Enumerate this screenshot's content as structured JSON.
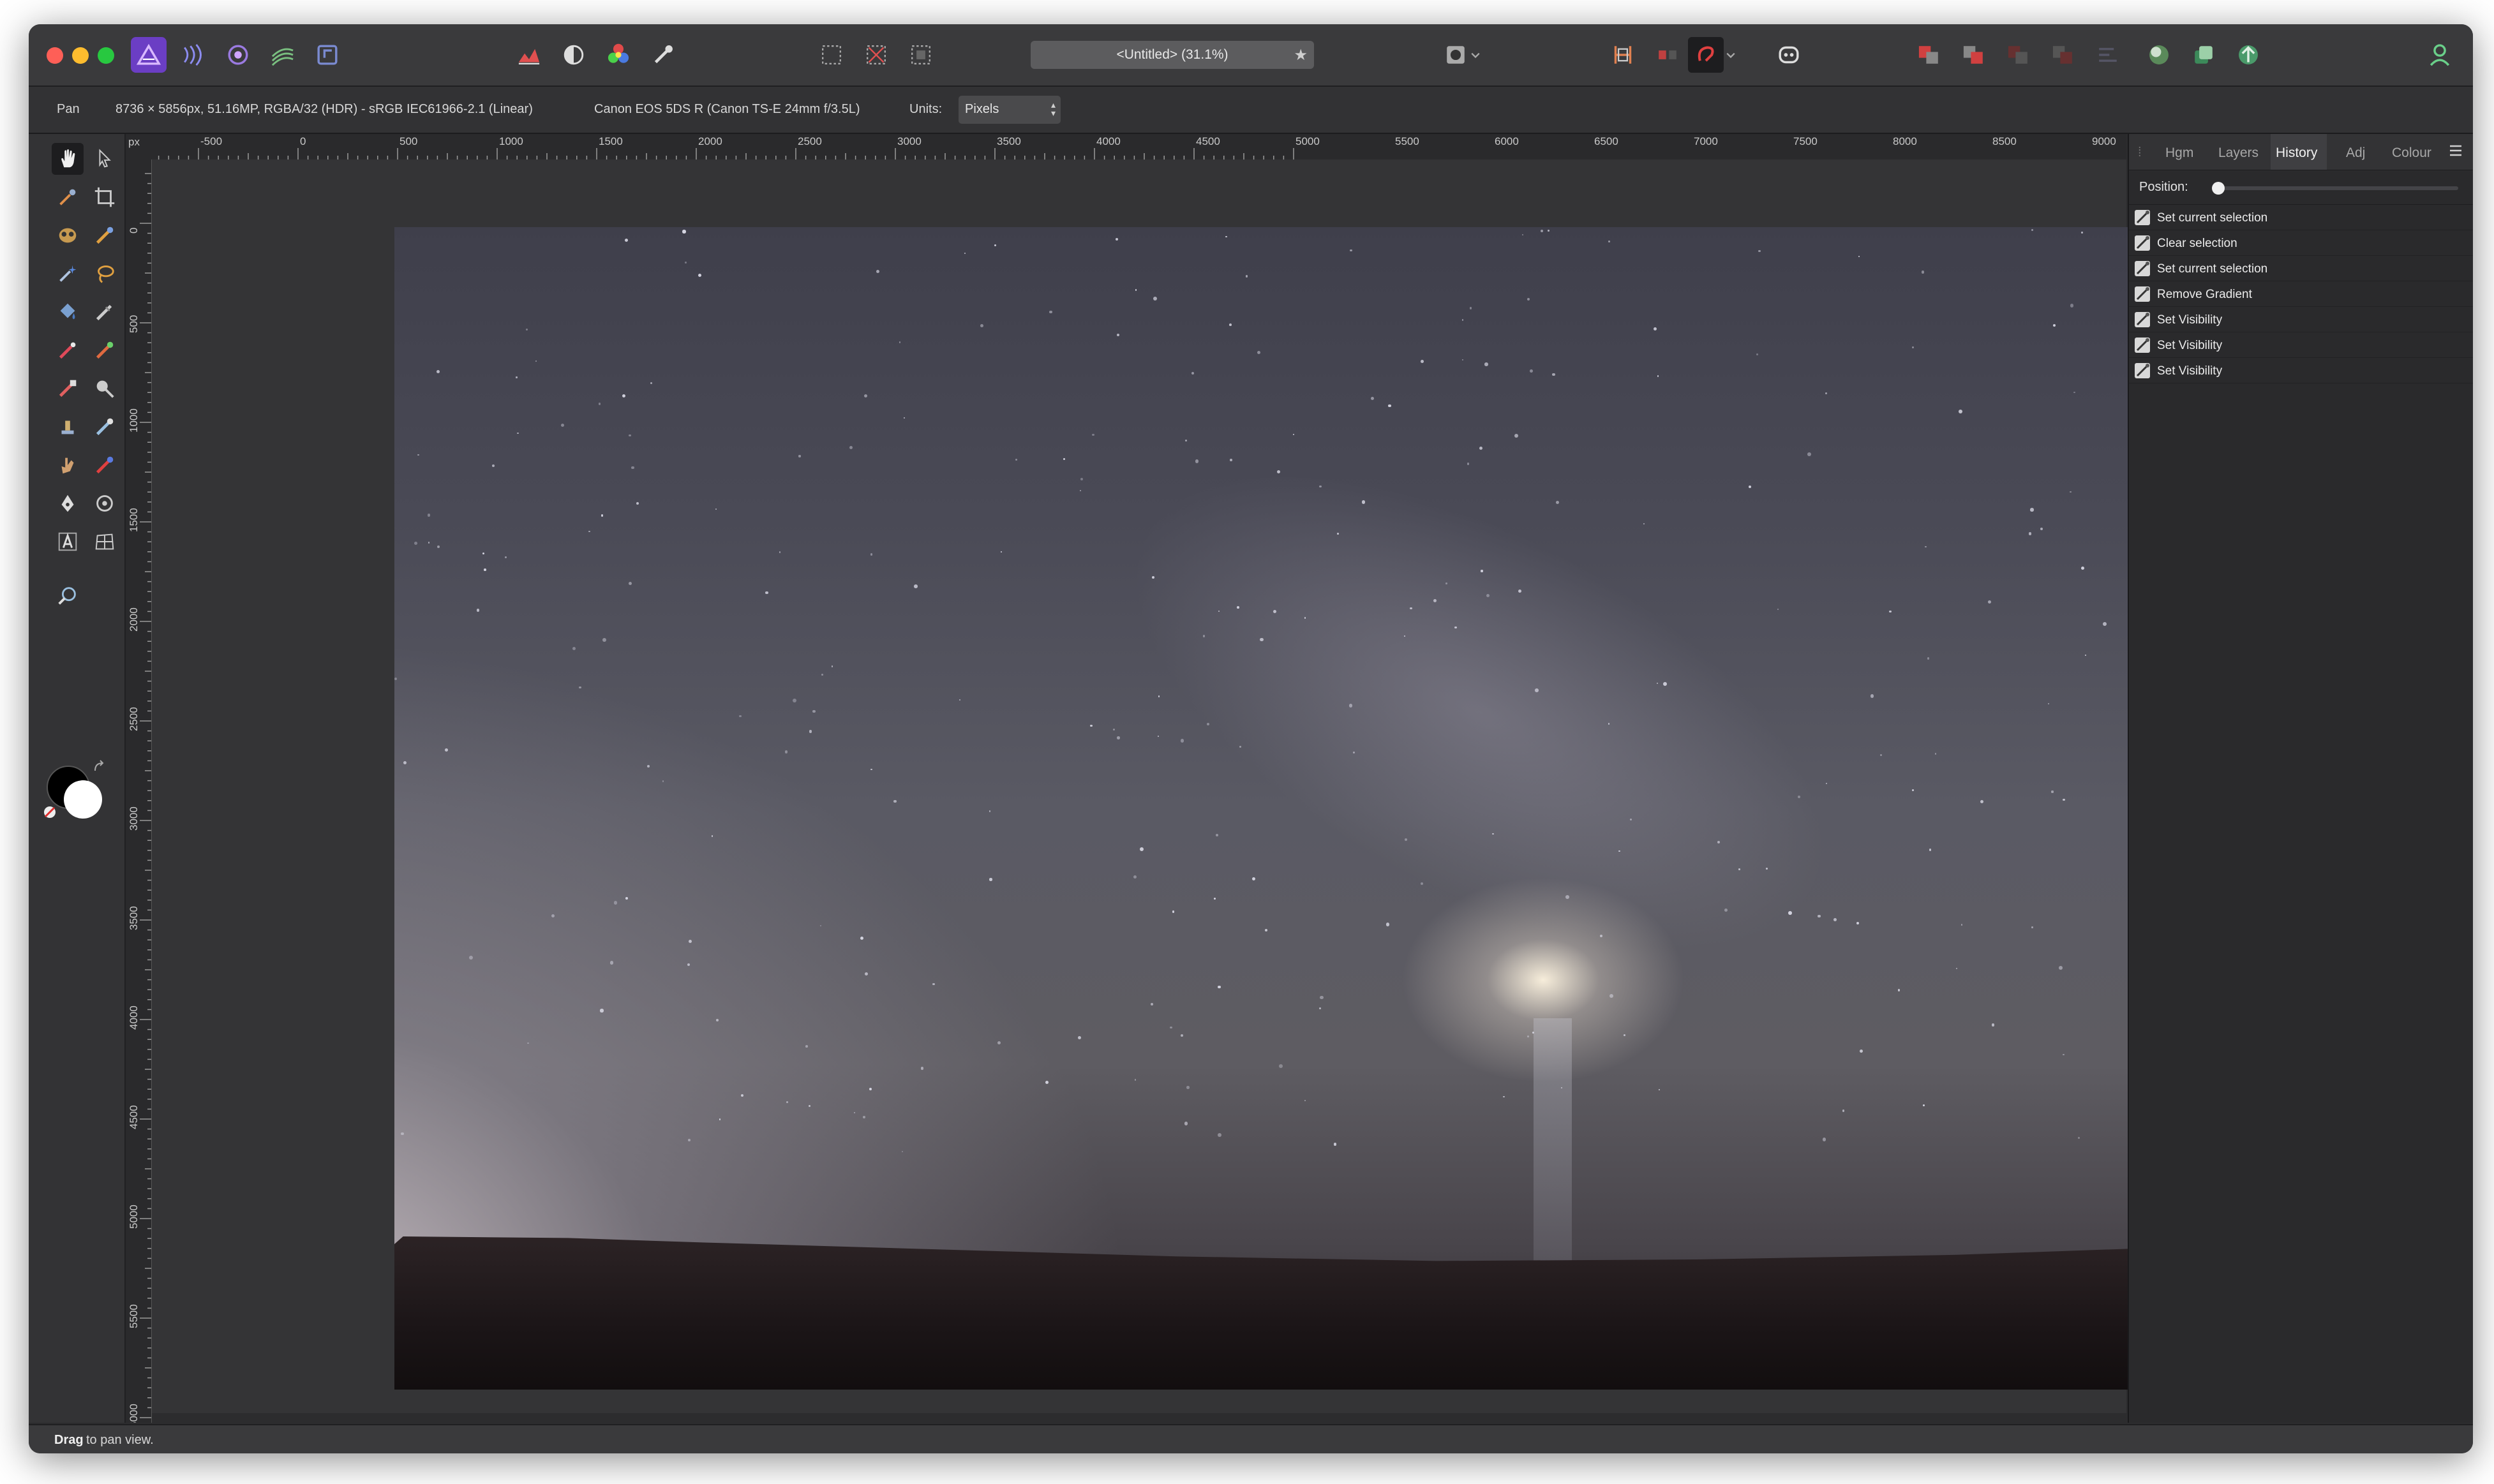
{
  "toolbar": {
    "document_title": "<Untitled> (31.1%)",
    "document_modified_mark": "★"
  },
  "context": {
    "tool_name": "Pan",
    "doc_info": "8736 × 5856px, 51.16MP, RGBA/32 (HDR) - sRGB IEC61966-2.1 (Linear)",
    "camera_info": "Canon EOS 5DS R (Canon TS-E 24mm f/3.5L)",
    "units_label": "Units:",
    "units_value": "Pixels"
  },
  "ruler": {
    "unit": "px",
    "top_labels": [
      "-500",
      "0",
      "500",
      "1000",
      "1500",
      "2000",
      "2500",
      "3000",
      "3500",
      "4000",
      "4500",
      "5000",
      "5500",
      "6000",
      "6500",
      "7000",
      "7500",
      "8000",
      "8500",
      "9000"
    ],
    "left_labels": [
      "0",
      "500",
      "1000",
      "1500",
      "2000",
      "2500",
      "3000",
      "3500",
      "4000",
      "4500",
      "5000",
      "5500",
      "6000"
    ]
  },
  "panel": {
    "tabs": [
      "Hgm",
      "Layers",
      "History",
      "Adj",
      "Colour"
    ],
    "active_tab": "History",
    "position_label": "Position:",
    "position_value": 0,
    "history_items": [
      "Set current selection",
      "Clear selection",
      "Set current selection",
      "Remove Gradient",
      "Set Visibility",
      "Set Visibility",
      "Set Visibility"
    ]
  },
  "status": {
    "strong": "Drag",
    "rest": "to pan view."
  },
  "colors": {
    "accent_persona": "#8b4fd8",
    "foreground": "#000000",
    "background": "#ffffff"
  },
  "icons": {
    "persona": [
      "photo-persona-icon",
      "liquify-persona-icon",
      "develop-persona-icon",
      "tone-mapping-persona-icon",
      "export-persona-icon"
    ],
    "tools": [
      "hand-icon",
      "move-icon",
      "brush-icon",
      "crop-icon",
      "face-icon",
      "selection-brush-icon",
      "magic-wand-icon",
      "lasso-icon",
      "flood-fill-icon",
      "gradient-icon",
      "paint-brush-icon",
      "colour-replace-icon",
      "erase-icon",
      "zoom-dodge-icon",
      "clone-icon",
      "healing-icon",
      "smudge-icon",
      "mixer-icon",
      "pen-icon",
      "shape-icon",
      "text-icon",
      "mesh-icon",
      "zoom-icon"
    ]
  }
}
